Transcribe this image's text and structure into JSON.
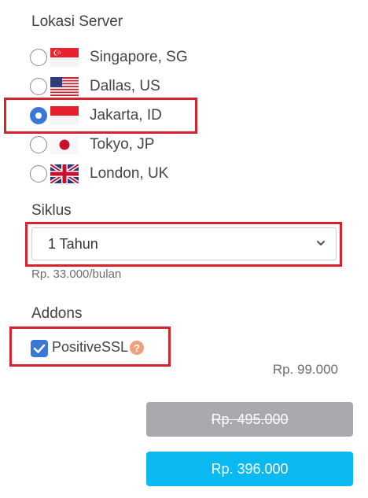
{
  "server_section": {
    "label": "Lokasi Server",
    "options": [
      {
        "name": "Singapore, SG",
        "flag": "singapore-flag-icon",
        "checked": false
      },
      {
        "name": "Dallas, US",
        "flag": "usa-flag-icon",
        "checked": false
      },
      {
        "name": "Jakarta, ID",
        "flag": "indonesia-flag-icon",
        "checked": true
      },
      {
        "name": "Tokyo, JP",
        "flag": "japan-flag-icon",
        "checked": false
      },
      {
        "name": "London, UK",
        "flag": "uk-flag-icon",
        "checked": false
      }
    ]
  },
  "cycle_section": {
    "label": "Siklus",
    "selected": "1 Tahun",
    "price_per_month": "Rp. 33.000/bulan"
  },
  "addons_section": {
    "label": "Addons",
    "item_label": "PositiveSSL",
    "item_checked": true,
    "help_glyph": "?",
    "item_price": "Rp. 99.000"
  },
  "buttons": {
    "original_price": "Rp. 495.000",
    "discount_price": "Rp. 396.000"
  },
  "colors": {
    "accent": "#3a78d8",
    "highlight": "#d7232d",
    "button_primary": "#09b9ef",
    "button_disabled": "#a9aaad"
  }
}
